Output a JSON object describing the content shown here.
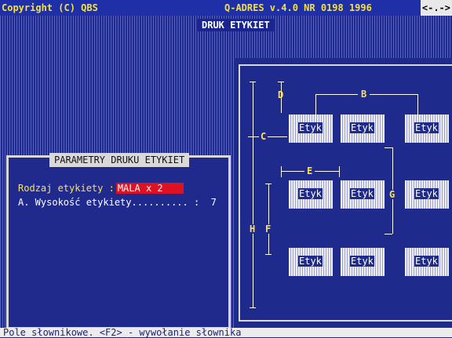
{
  "topbar": {
    "left": "Copyright (C) QBS",
    "center": "Q-ADRES v.4.0 NR 0198 1996",
    "right": "<-.->"
  },
  "header_badge": "DRUK ETYKIET",
  "panel": {
    "title": "PARAMETRY DRUKU ETYKIET",
    "rows": [
      {
        "label": "Rodzaj etykiety :",
        "value": "MALA x 2"
      },
      {
        "label": "A. Wysokość etykiety.......... :",
        "value": "7"
      }
    ]
  },
  "diagram": {
    "box_label": "Etyk",
    "labels": {
      "B": "B",
      "C": "C",
      "D": "D",
      "E": "E",
      "F": "F",
      "G": "G",
      "H": "H"
    }
  },
  "statusbar": "Pole słownikowe.  <F2> - wywołanie słownika",
  "colors": {
    "background": "#1e2a8c",
    "accent": "#dd1222",
    "yellow": "#ffe24c"
  }
}
